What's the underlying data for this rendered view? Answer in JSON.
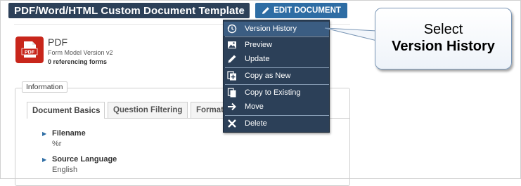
{
  "header": {
    "title": "PDF/Word/HTML Custom Document Template",
    "edit_button": "EDIT DOCUMENT"
  },
  "document": {
    "type": "PDF",
    "icon": "pdf-file-icon",
    "version": "Form Model Version v2",
    "references": "0 referencing forms"
  },
  "fieldset": {
    "legend": "Information"
  },
  "tabs": [
    {
      "label": "Document Basics",
      "active": true
    },
    {
      "label": "Question Filtering",
      "active": false
    },
    {
      "label": "Formatting",
      "active": false
    }
  ],
  "fields": [
    {
      "label": "Filename",
      "value": "%r"
    },
    {
      "label": "Source Language",
      "value": "English"
    }
  ],
  "menu": {
    "items": [
      {
        "label": "Version History",
        "icon": "history-icon",
        "selected": true
      },
      {
        "label": "Preview",
        "icon": "image-icon",
        "selected": false
      },
      {
        "label": "Update",
        "icon": "pencil-icon",
        "selected": false
      },
      {
        "label": "Copy as New",
        "icon": "copy-new-icon",
        "selected": false
      },
      {
        "label": "Copy to Existing",
        "icon": "copy-icon",
        "selected": false
      },
      {
        "label": "Move",
        "icon": "arrow-right-icon",
        "selected": false
      },
      {
        "label": "Delete",
        "icon": "close-icon",
        "selected": false
      }
    ]
  },
  "callout": {
    "line1": "Select",
    "line2": "Version History"
  },
  "colors": {
    "nav_dark": "#2c4058",
    "primary_button": "#2e6da4",
    "menu_selected": "#3b5d82",
    "pdf_red": "#c8261b"
  }
}
